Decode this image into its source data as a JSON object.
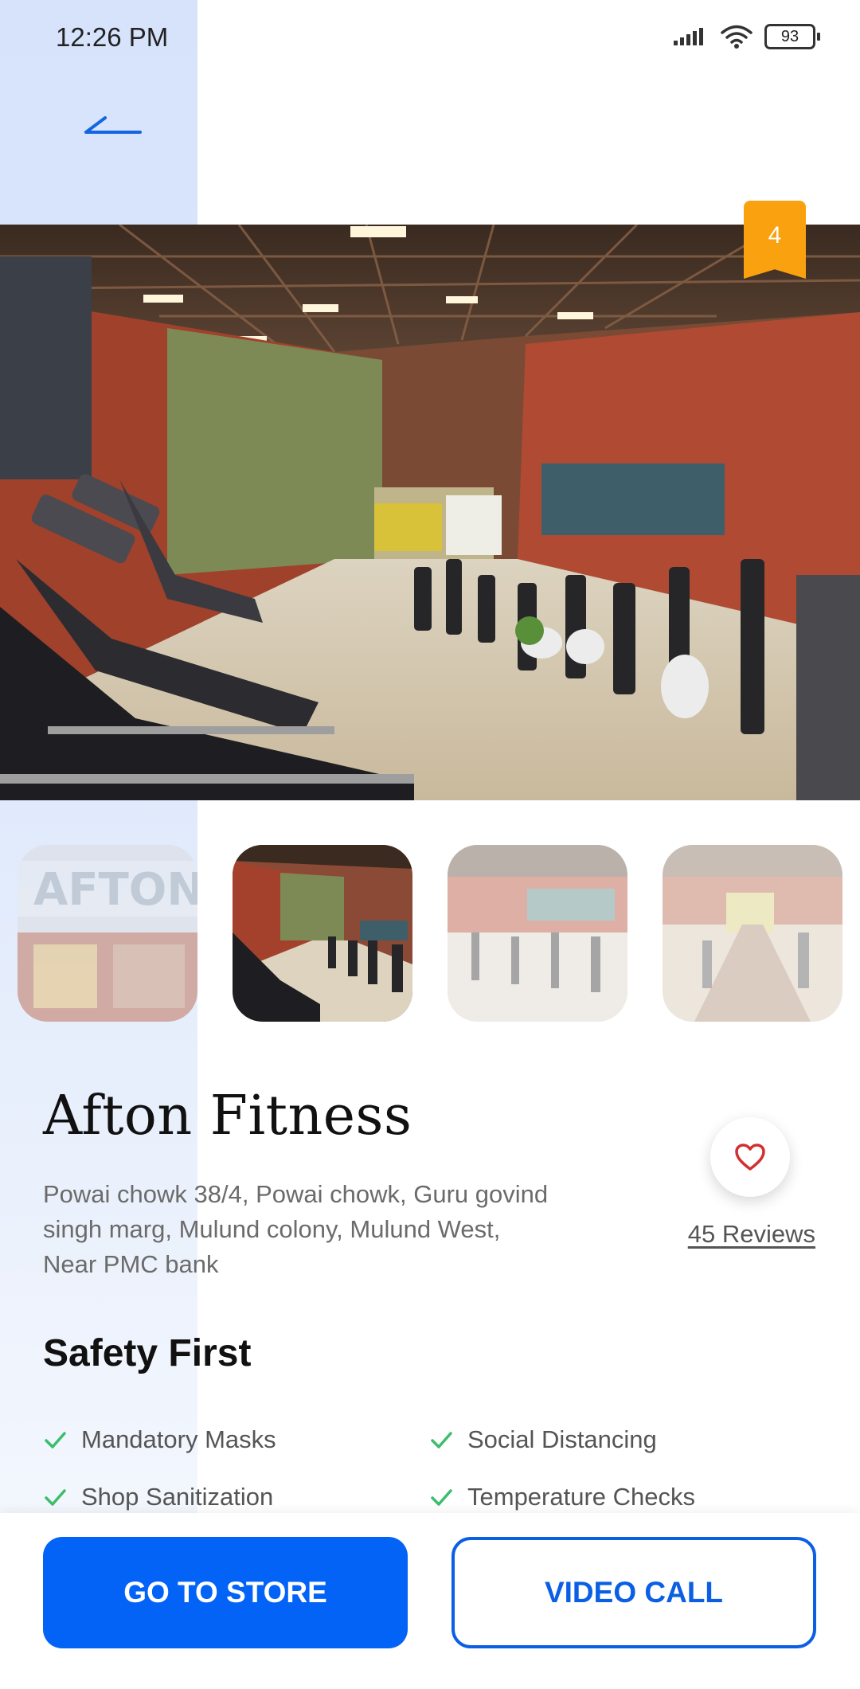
{
  "status_bar": {
    "time": "12:26 PM",
    "battery": "93"
  },
  "hero": {
    "badge": "4"
  },
  "store": {
    "name": "Afton Fitness",
    "address": "Powai chowk  38/4, Powai chowk, Guru govind singh marg, Mulund colony, Mulund West, Near PMC bank",
    "reviews": "45 Reviews"
  },
  "safety": {
    "title": "Safety First",
    "items": [
      "Mandatory Masks",
      "Social Distancing",
      "Shop Sanitization",
      "Temperature Checks"
    ]
  },
  "actions": {
    "primary": "GO TO STORE",
    "secondary": "VIDEO CALL"
  },
  "colors": {
    "accent": "#0463f7",
    "badge": "#f9a10f",
    "check": "#3dbd6d",
    "heart": "#d32f2f"
  }
}
